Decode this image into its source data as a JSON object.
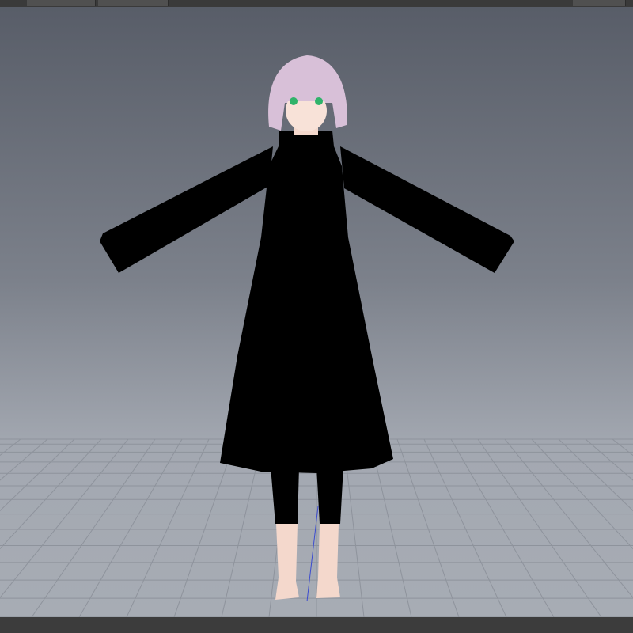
{
  "toolbar": {
    "buttons": [
      {
        "name": "left-tab-1"
      },
      {
        "name": "left-tab-2"
      },
      {
        "name": "right-tab"
      }
    ]
  },
  "viewport": {
    "background_top": "#585d68",
    "background_bottom": "#a7acb4",
    "grid_color": "#8e939c",
    "model": {
      "hair_color": "#d8c0d8",
      "eye_color": "#2fb36a",
      "outfit_color": "#000000",
      "skin_color": "#f6dcd0"
    }
  }
}
